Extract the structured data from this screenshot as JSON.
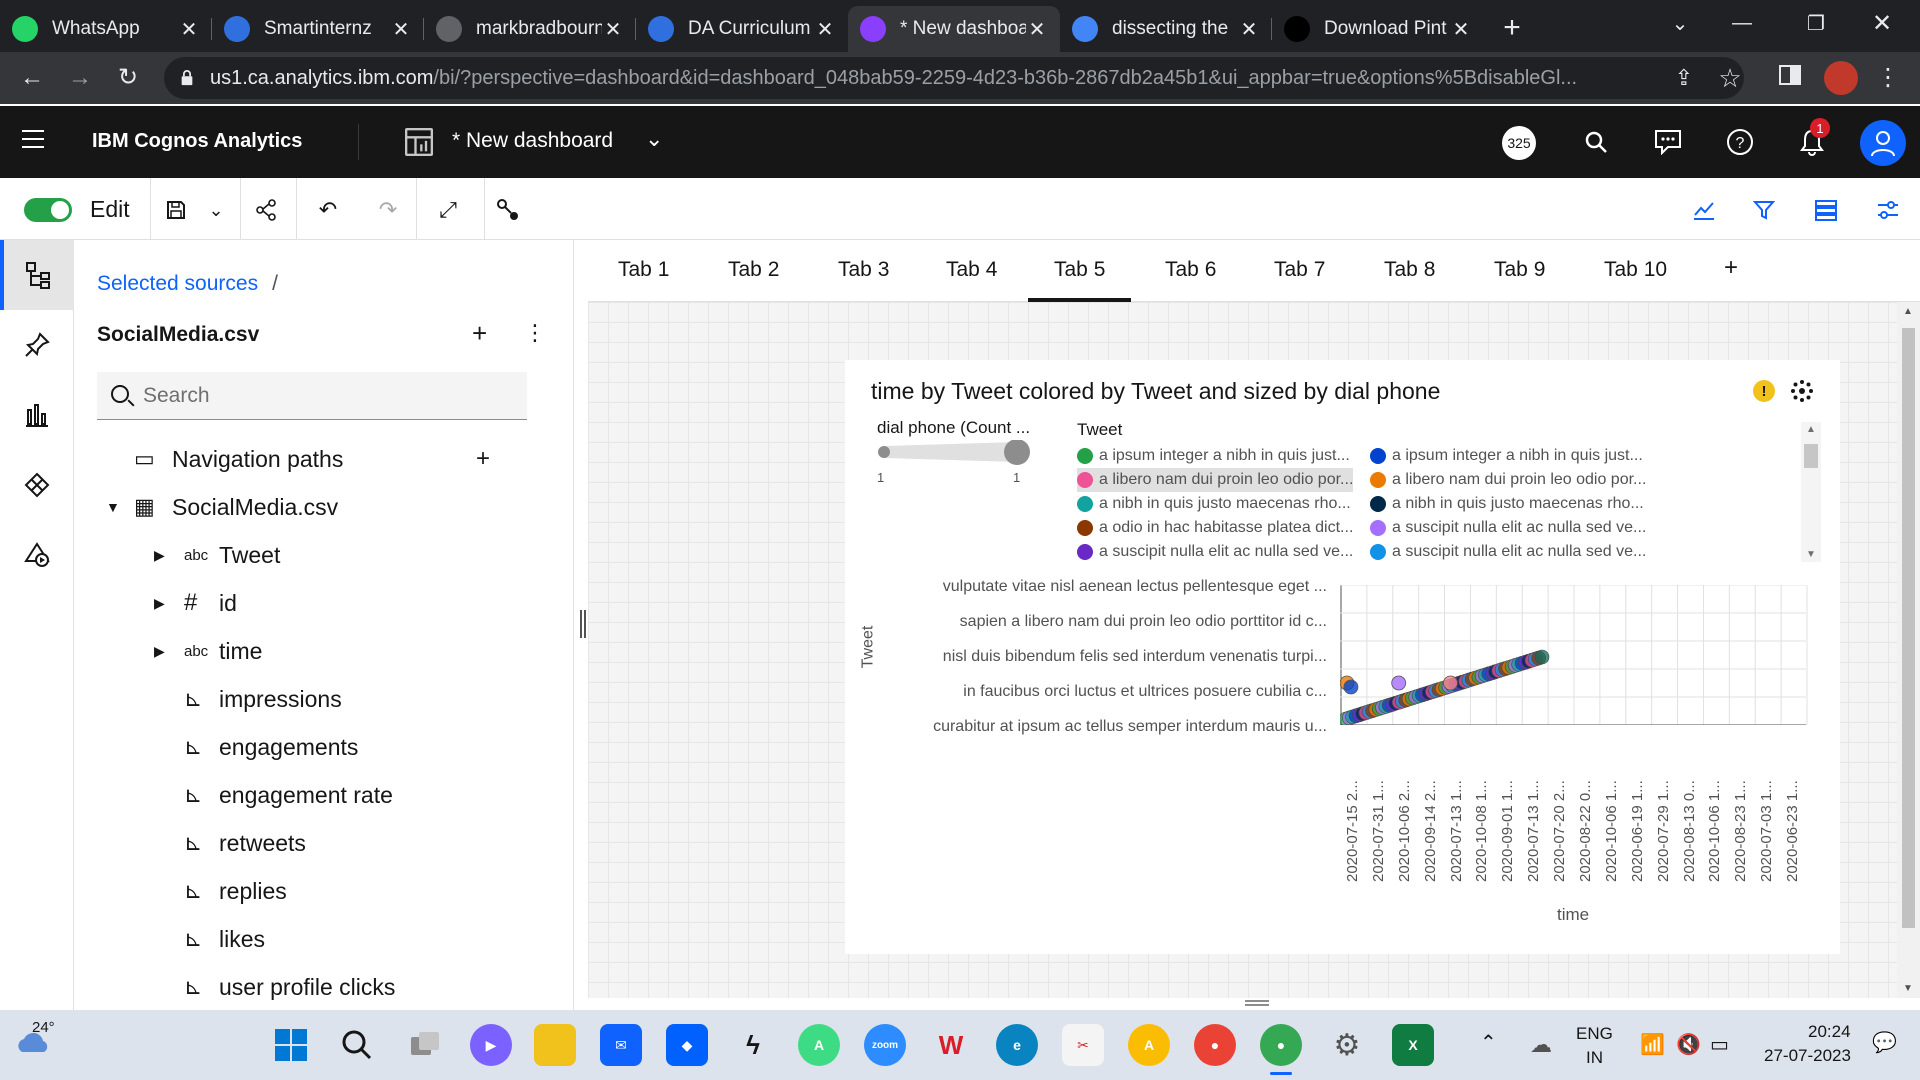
{
  "browser": {
    "tabs": [
      {
        "title": "WhatsApp",
        "icon": "whatsapp-icon",
        "color": "#25d366"
      },
      {
        "title": "Smartinternz",
        "icon": "smartinternz-icon",
        "color": "#2f6fde"
      },
      {
        "title": "markbradbourn",
        "icon": "markbradbourn-icon",
        "color": "#5f6368"
      },
      {
        "title": "DA Curriculum",
        "icon": "curriculum-icon",
        "color": "#2f6fde"
      },
      {
        "title": "* New dashboa",
        "icon": "cognos-icon",
        "color": "#8a3ffc"
      },
      {
        "title": "dissecting the",
        "icon": "google-icon",
        "color": "#4285f4"
      },
      {
        "title": "Download Pint",
        "icon": "download-icon",
        "color": "#000000"
      }
    ],
    "url_host": "us1.ca.analytics.ibm.com",
    "url_rest": "/bi/?perspective=dashboard&id=dashboard_048bab59-2259-4d23-b36b-2867db2a45b1&ui_appbar=true&options%5BdisableGl..."
  },
  "app": {
    "product_name": "IBM Cognos Analytics",
    "dashboard_name": "* New dashboard",
    "status_count": "325",
    "notification_count": "1"
  },
  "toolbar": {
    "edit_label": "Edit"
  },
  "source_panel": {
    "breadcrumb": "Selected sources",
    "breadcrumb_sep": "/",
    "source_name": "SocialMedia.csv",
    "search_placeholder": "Search",
    "tree": [
      {
        "label": "Navigation paths",
        "type": "folder"
      },
      {
        "label": "SocialMedia.csv",
        "type": "table"
      },
      {
        "label": "Tweet",
        "type": "text"
      },
      {
        "label": "id",
        "type": "number"
      },
      {
        "label": "time",
        "type": "text"
      },
      {
        "label": "impressions",
        "type": "measure"
      },
      {
        "label": "engagements",
        "type": "measure"
      },
      {
        "label": "engagement rate",
        "type": "measure"
      },
      {
        "label": "retweets",
        "type": "measure"
      },
      {
        "label": "replies",
        "type": "measure"
      },
      {
        "label": "likes",
        "type": "measure"
      },
      {
        "label": "user profile clicks",
        "type": "measure"
      }
    ]
  },
  "tabs": [
    "Tab 1",
    "Tab 2",
    "Tab 3",
    "Tab 4",
    "Tab 5",
    "Tab 6",
    "Tab 7",
    "Tab 8",
    "Tab 9",
    "Tab 10"
  ],
  "active_tab": "Tab 5",
  "chart_data": {
    "type": "scatter",
    "title": "time by Tweet colored by Tweet and sized by dial phone",
    "xlabel": "time",
    "ylabel": "Tweet",
    "size_legend": {
      "title": "dial phone (Count ...",
      "min": "1",
      "max": "1"
    },
    "color_legend_title": "Tweet",
    "legend": [
      {
        "name": "a ipsum integer a nibh in quis just...",
        "color": "#24a148"
      },
      {
        "name": "a ipsum integer a nibh in quis just...",
        "color": "#0043ce"
      },
      {
        "name": "a libero nam dui proin leo odio por...",
        "color": "#ee5396"
      },
      {
        "name": "a libero nam dui proin leo odio por...",
        "color": "#eb7a00"
      },
      {
        "name": "a nibh in quis justo maecenas rho...",
        "color": "#12a3a0"
      },
      {
        "name": "a nibh in quis justo maecenas rho...",
        "color": "#012749"
      },
      {
        "name": "a odio in hac habitasse platea dict...",
        "color": "#8a3800"
      },
      {
        "name": "a suscipit nulla elit ac nulla sed ve...",
        "color": "#a56eff"
      },
      {
        "name": "a suscipit nulla elit ac nulla sed ve...",
        "color": "#6929c4"
      },
      {
        "name": "a suscipit nulla elit ac nulla sed ve...",
        "color": "#1192e8"
      }
    ],
    "y_categories": [
      "vulputate vitae nisl aenean lectus pellentesque eget ...",
      "sapien a libero nam dui proin leo odio porttitor id c...",
      "nisl duis bibendum felis sed interdum venenatis turpi...",
      "in faucibus orci luctus et ultrices posuere cubilia c...",
      "curabitur at ipsum ac tellus semper interdum mauris u..."
    ],
    "x_categories": [
      "2020-07-15 2...",
      "2020-07-31 1...",
      "2020-10-06 2...",
      "2020-09-14 2...",
      "2020-07-13 1...",
      "2020-10-08 1...",
      "2020-09-01 1...",
      "2020-07-13 1...",
      "2020-07-20 2...",
      "2020-08-22 0...",
      "2020-10-06 1...",
      "2020-06-19 1...",
      "2020-07-29 1...",
      "2020-08-13 0...",
      "2020-10-06 1...",
      "2020-08-23 1...",
      "2020-07-03 1...",
      "2020-06-23 1..."
    ],
    "highlighted_points": [
      {
        "x": "2020-07-15 2...",
        "y": "in faucibus orci luctus et ultrices posuere cubilia c...",
        "color": "#eb7a00"
      },
      {
        "x": "2020-07-15 2...",
        "y": "in faucibus orci luctus et ultrices posuere cubilia c...",
        "color": "#0043ce"
      },
      {
        "x": "2020-10-06 2...",
        "y": "in faucibus orci luctus et ultrices posuere cubilia c...",
        "color": "#a56eff"
      },
      {
        "x": "2020-07-13 1...",
        "y": "in faucibus orci luctus et ultrices posuere cubilia c...",
        "color": "#ff8389"
      }
    ]
  },
  "taskbar": {
    "temperature": "24°",
    "language": "ENG",
    "region": "IN",
    "time": "20:24",
    "date": "27-07-2023"
  }
}
